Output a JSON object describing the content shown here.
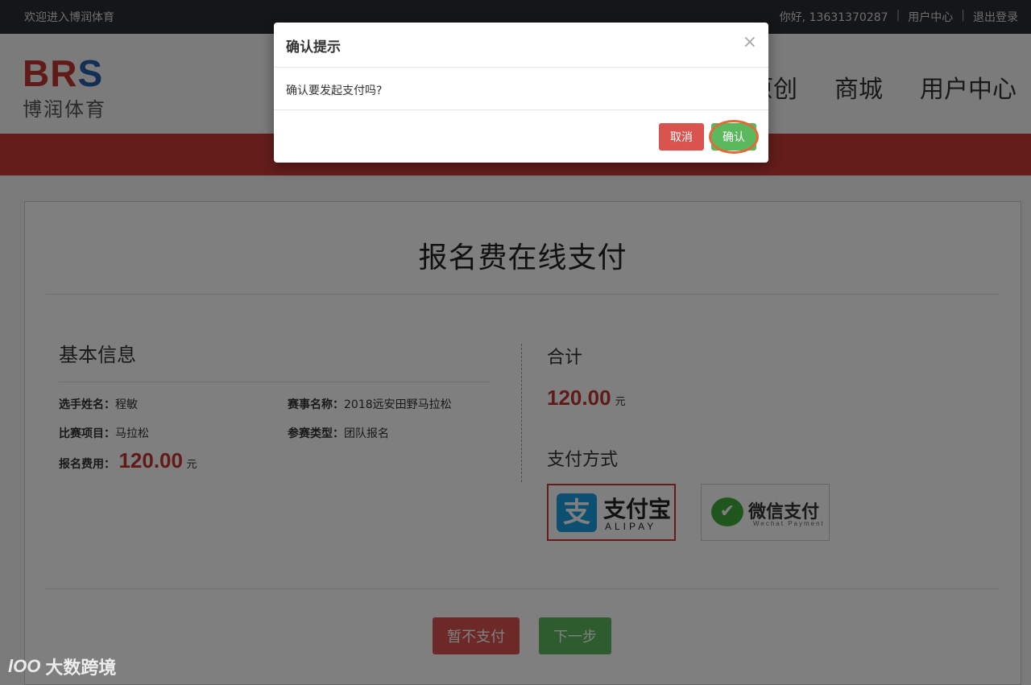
{
  "topbar": {
    "welcome": "欢迎进入博润体育",
    "greeting": "你好, 13631370287",
    "user_center": "用户中心",
    "logout": "退出登录",
    "separator": "|"
  },
  "logo": {
    "brand_letters": "BR",
    "brand_s": "S",
    "brand_cn": "博润体育"
  },
  "nav": {
    "item1": "原创",
    "item2": "商城",
    "item3": "用户中心"
  },
  "page": {
    "title": "报名费在线支付",
    "basic_info": {
      "heading": "基本信息",
      "player_label": "选手姓名：",
      "player_value": "程敏",
      "event_label": "赛事名称：",
      "event_value": "2018远安田野马拉松",
      "item_label": "比赛项目：",
      "item_value": "马拉松",
      "type_label": "参赛类型：",
      "type_value": "团队报名",
      "fee_label": "报名费用：",
      "fee_value": "120.00",
      "fee_unit": "元"
    },
    "summary": {
      "total_label": "合计",
      "total_value": "120.00",
      "total_unit": "元",
      "payment_label": "支付方式",
      "alipay_cn": "支付宝",
      "alipay_en": "ALIPAY",
      "alipay_mark": "支",
      "wechat_cn": "微信支付",
      "wechat_en": "Wechat  Payment",
      "wechat_mark": "✔"
    },
    "buttons": {
      "no_pay": "暂不支付",
      "next": "下一步"
    }
  },
  "modal": {
    "title": "确认提示",
    "close": "×",
    "message": "确认要发起支付吗?",
    "cancel": "取消",
    "confirm": "确认"
  },
  "watermark": {
    "icon": "lOO",
    "text": "大数跨境"
  },
  "colors": {
    "brand_red": "#c93a37",
    "success_green": "#5cb85c",
    "danger_red": "#d9534f",
    "alipay_blue": "#1a9fe0",
    "wechat_green": "#3fad3c",
    "highlight_ring": "#e06a3a"
  }
}
